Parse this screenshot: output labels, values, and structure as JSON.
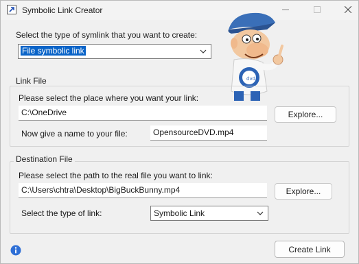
{
  "window": {
    "title": "Symbolic Link Creator"
  },
  "symlink_type": {
    "prompt": "Select the type of symlink that you want to create:",
    "selected": "File symbolic link"
  },
  "link_file": {
    "group_title": "Link File",
    "place_prompt": "Please select the place where you want your link:",
    "place_value": "C:\\OneDrive",
    "name_prompt": "Now give a name to your file:",
    "name_value": "OpensourceDVD.mp4",
    "explore_label": "Explore..."
  },
  "destination_file": {
    "group_title": "Destination File",
    "path_prompt": "Please select the path to the real file you want to link:",
    "path_value": "C:\\Users\\chtra\\Desktop\\BigBuckBunny.mp4",
    "explore_label": "Explore...",
    "link_type_prompt": "Select the type of link:",
    "link_type_selected": "Symbolic Link"
  },
  "footer": {
    "create_label": "Create Link"
  },
  "icons": {
    "app": "link-shortcut-icon",
    "info": "info-icon",
    "mascot": "opensourcedvd-mascot"
  },
  "colors": {
    "selection": "#0a64c8",
    "info_blue": "#2e6fd6"
  }
}
